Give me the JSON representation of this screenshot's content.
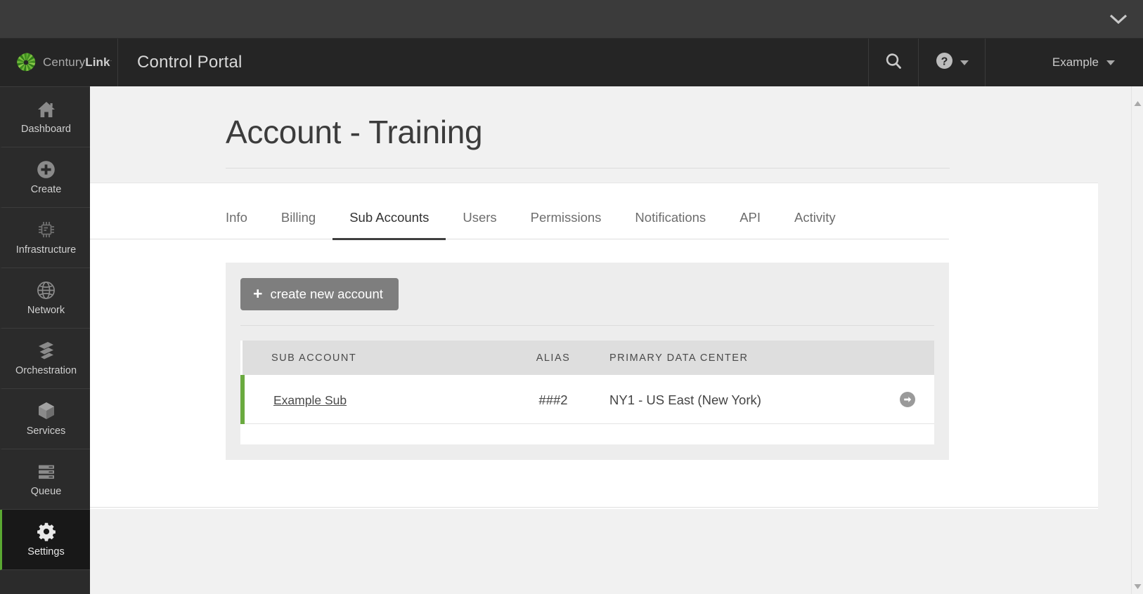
{
  "window": {
    "chrome_chevron_icon": "chevron-down-icon"
  },
  "header": {
    "brand_name_light": "Century",
    "brand_name_bold": "Link",
    "brand_trademark": "·",
    "logo_icon": "centurylink-sunburst-logo",
    "portal_title": "Control Portal",
    "search_icon": "search-icon",
    "help_icon": "help-question-icon",
    "help_caret_icon": "caret-down-icon",
    "user_label": "Example",
    "user_caret_icon": "caret-down-icon"
  },
  "sidebar": {
    "items": [
      {
        "label": "Dashboard",
        "icon": "home-icon",
        "active": false
      },
      {
        "label": "Create",
        "icon": "plus-circle-icon",
        "active": false
      },
      {
        "label": "Infrastructure",
        "icon": "cpu-chip-icon",
        "active": false
      },
      {
        "label": "Network",
        "icon": "globe-icon",
        "active": false
      },
      {
        "label": "Orchestration",
        "icon": "layers-icon",
        "active": false
      },
      {
        "label": "Services",
        "icon": "cube-icon",
        "active": false
      },
      {
        "label": "Queue",
        "icon": "server-stack-icon",
        "active": false
      },
      {
        "label": "Settings",
        "icon": "gear-icon",
        "active": true
      }
    ]
  },
  "page": {
    "title": "Account - Training"
  },
  "tabs": [
    {
      "label": "Info",
      "active": false
    },
    {
      "label": "Billing",
      "active": false
    },
    {
      "label": "Sub Accounts",
      "active": true
    },
    {
      "label": "Users",
      "active": false
    },
    {
      "label": "Permissions",
      "active": false
    },
    {
      "label": "Notifications",
      "active": false
    },
    {
      "label": "API",
      "active": false
    },
    {
      "label": "Activity",
      "active": false
    }
  ],
  "sub_accounts_panel": {
    "create_button_label": "create new account",
    "create_button_icon": "plus-icon",
    "table": {
      "columns": [
        "SUB ACCOUNT",
        "ALIAS",
        "PRIMARY DATA CENTER"
      ],
      "rows": [
        {
          "sub_account": "Example Sub",
          "alias": "###2",
          "primary_data_center": "NY1 - US East (New York)",
          "go_icon": "arrow-right-circle-icon",
          "status_color": "#6aaa3f"
        }
      ]
    }
  },
  "scrollbar": {
    "up_icon": "scroll-up-arrow-icon",
    "down_icon": "scroll-down-arrow-icon"
  },
  "colors": {
    "accent_green": "#6aaa3f",
    "header_dark": "#252525",
    "sidebar_dark": "#2b2b2b",
    "active_nav": "#181818",
    "button_gray": "#7e7e7e"
  }
}
